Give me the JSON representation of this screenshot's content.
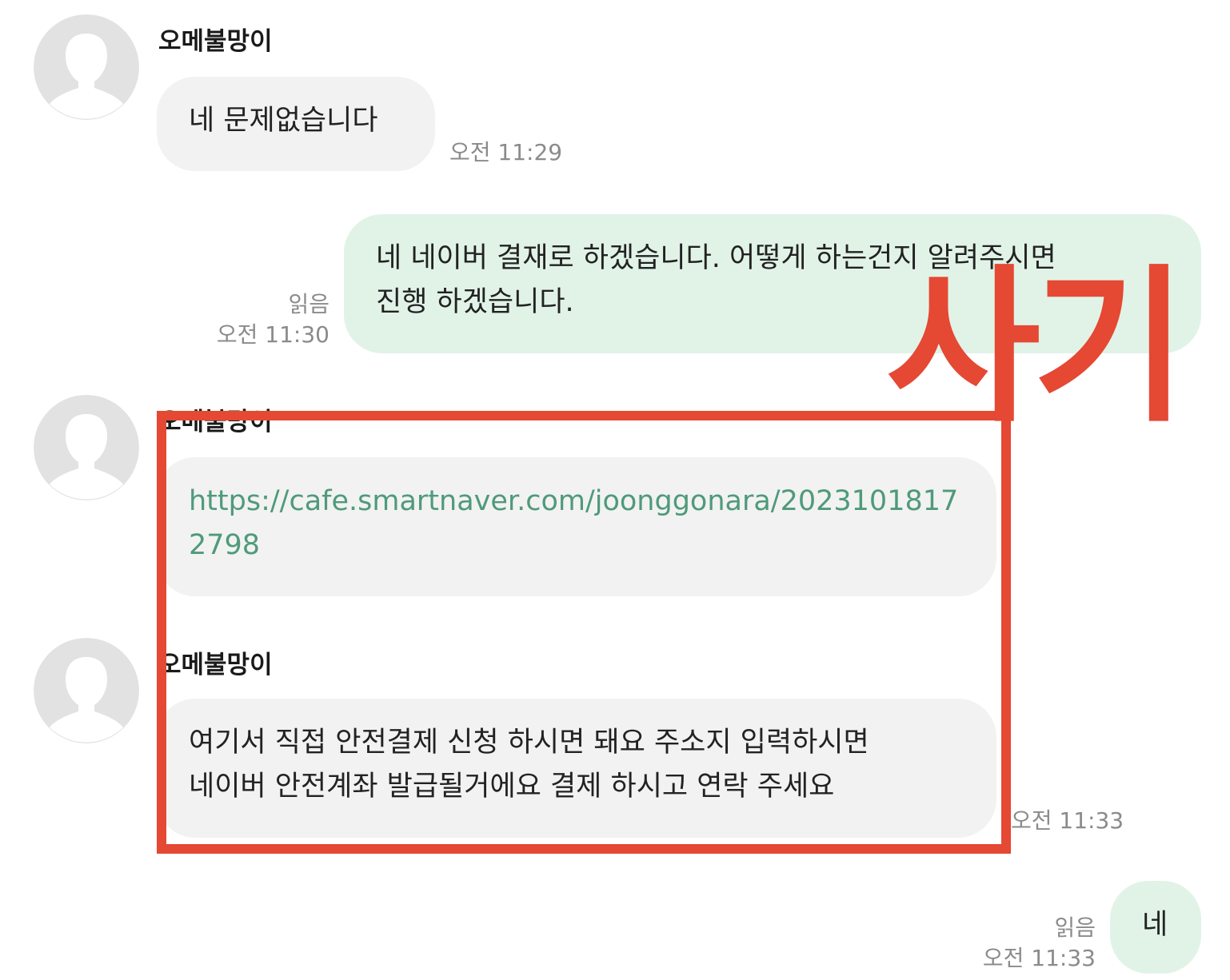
{
  "messages": [
    {
      "sender": "오메불망이",
      "lines": [
        "네 문제없습니다"
      ],
      "time": "오전 11:29"
    },
    {
      "lines": [
        "네 네이버 결재로 하겠습니다. 어떻게 하는건지 알려주시면",
        "진행 하겠습니다."
      ],
      "read": "읽음",
      "time": "오전 11:30"
    },
    {
      "sender": "오메불망이",
      "lines": [
        "https://cafe.smartnaver.com/joonggonara/2023101817",
        "2798"
      ]
    },
    {
      "sender": "오메불망이",
      "lines": [
        "여기서 직접 안전결제 신청 하시면 돼요 주소지 입력하시면",
        "네이버 안전계좌 발급될거에요 결제 하시고 연락 주세요"
      ],
      "time": "오전 11:33"
    },
    {
      "lines": [
        "네"
      ],
      "read": "읽음",
      "time": "오전 11:33"
    }
  ],
  "annotation": {
    "label": "사기",
    "color": "#e54833"
  },
  "colors": {
    "incoming_bubble": "#f2f2f2",
    "outgoing_bubble": "#e1f3e7",
    "link_text": "#4f9a7a",
    "meta_text": "#8b8b8b"
  }
}
